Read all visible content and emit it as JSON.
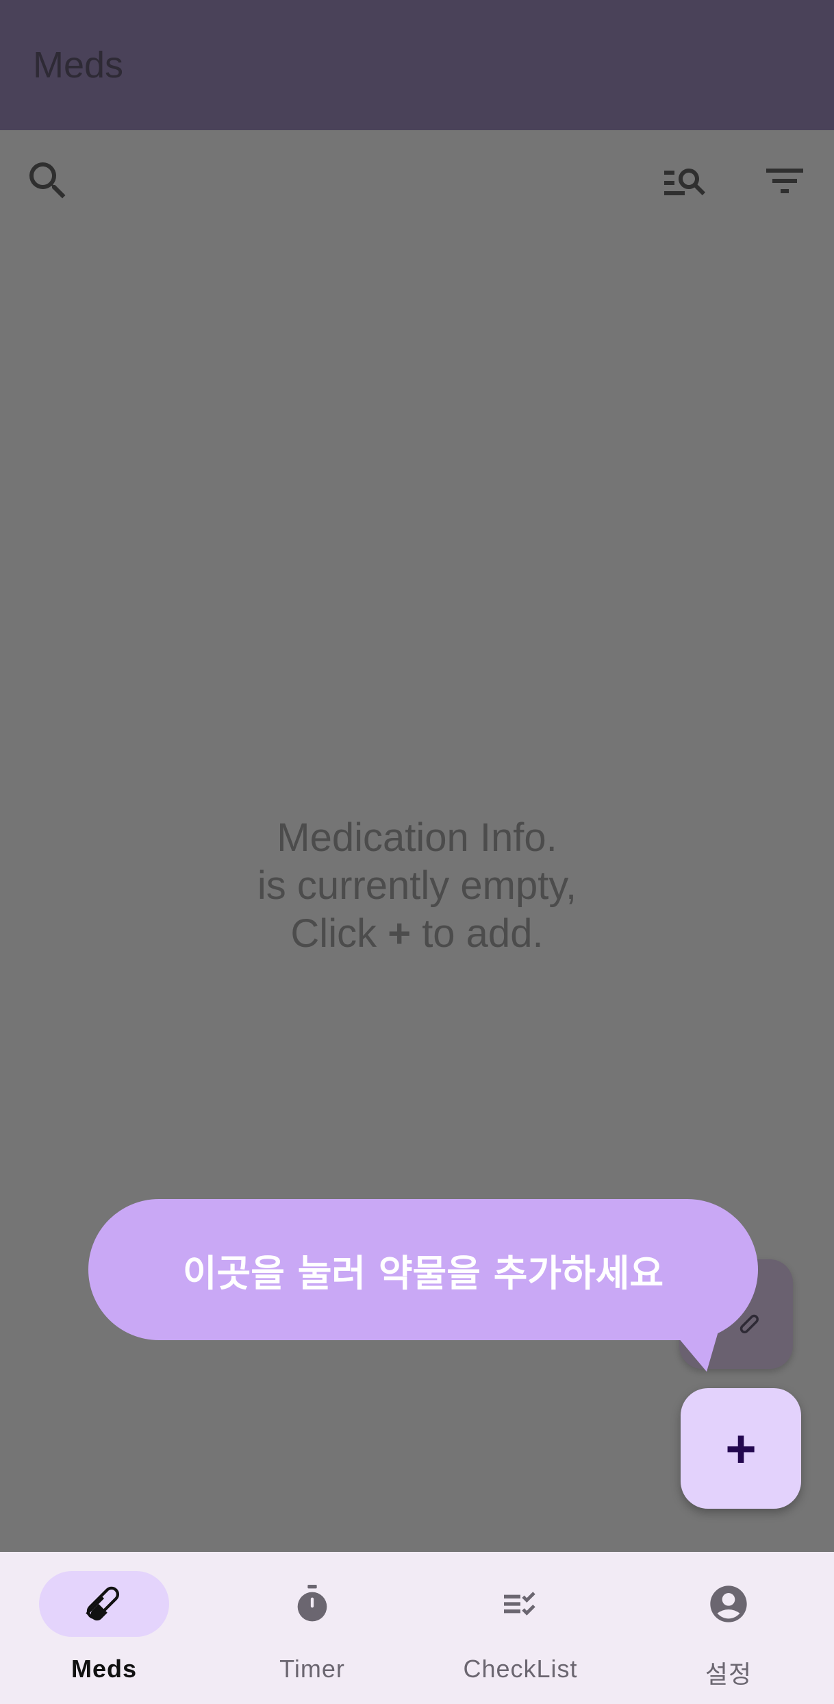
{
  "app_bar": {
    "title": "Meds"
  },
  "toolbar": {
    "icons": [
      "search-icon",
      "manage-search-icon",
      "filter-icon"
    ]
  },
  "empty_state": {
    "line1": "Medication Info.",
    "line2": "is currently empty,",
    "line3_before": "Click ",
    "line3_symbol": "+",
    "line3_after": " to add."
  },
  "tooltip": {
    "text": "이곳을 눌러 약물을 추가하세요"
  },
  "fab": {
    "symbol": "+",
    "icon": "add-icon"
  },
  "small_fab": {
    "icon": "pill-icon"
  },
  "bottom_nav": {
    "items": [
      {
        "label": "Meds",
        "icon": "pill-icon",
        "active": true
      },
      {
        "label": "Timer",
        "icon": "timer-icon",
        "active": false
      },
      {
        "label": "CheckList",
        "icon": "checklist-icon",
        "active": false
      },
      {
        "label": "설정",
        "icon": "account-circle-icon",
        "active": false
      }
    ]
  },
  "colors": {
    "app_bar": "#4a4259",
    "scrim_background": "#757575",
    "tooltip": "#c9a8f5",
    "fab": "#e3d2fc",
    "nav_active_pill": "#e4d4fc",
    "nav_background": "#f2ebf5"
  }
}
